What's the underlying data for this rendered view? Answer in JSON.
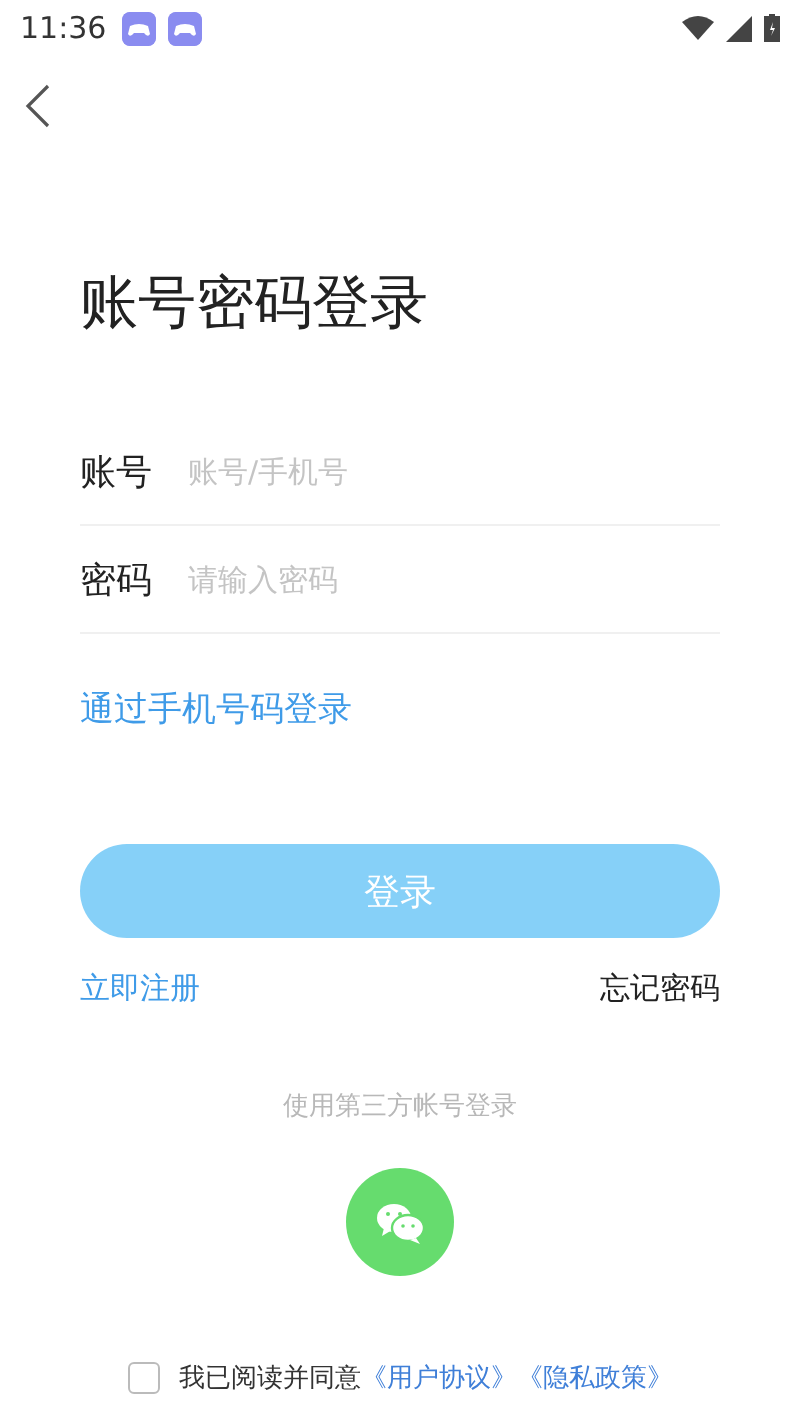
{
  "status_bar": {
    "time": "11:36",
    "notification_icons": [
      {
        "kind": "app"
      },
      {
        "kind": "app"
      }
    ]
  },
  "title": "账号密码登录",
  "fields": [
    {
      "label": "账号",
      "placeholder": "账号/手机号"
    },
    {
      "label": "密码",
      "placeholder": "请输入密码"
    }
  ],
  "phone_login_link": "通过手机号码登录",
  "login_button": {
    "label": "登录",
    "disabled": true
  },
  "register_link": "立即注册",
  "forgot_link": "忘记密码",
  "third_party_label": "使用第三方帐号登录",
  "agreement": {
    "checked": false,
    "text": "我已阅读并同意",
    "links": [
      "《用户协议》",
      "《隐私政策》"
    ]
  }
}
